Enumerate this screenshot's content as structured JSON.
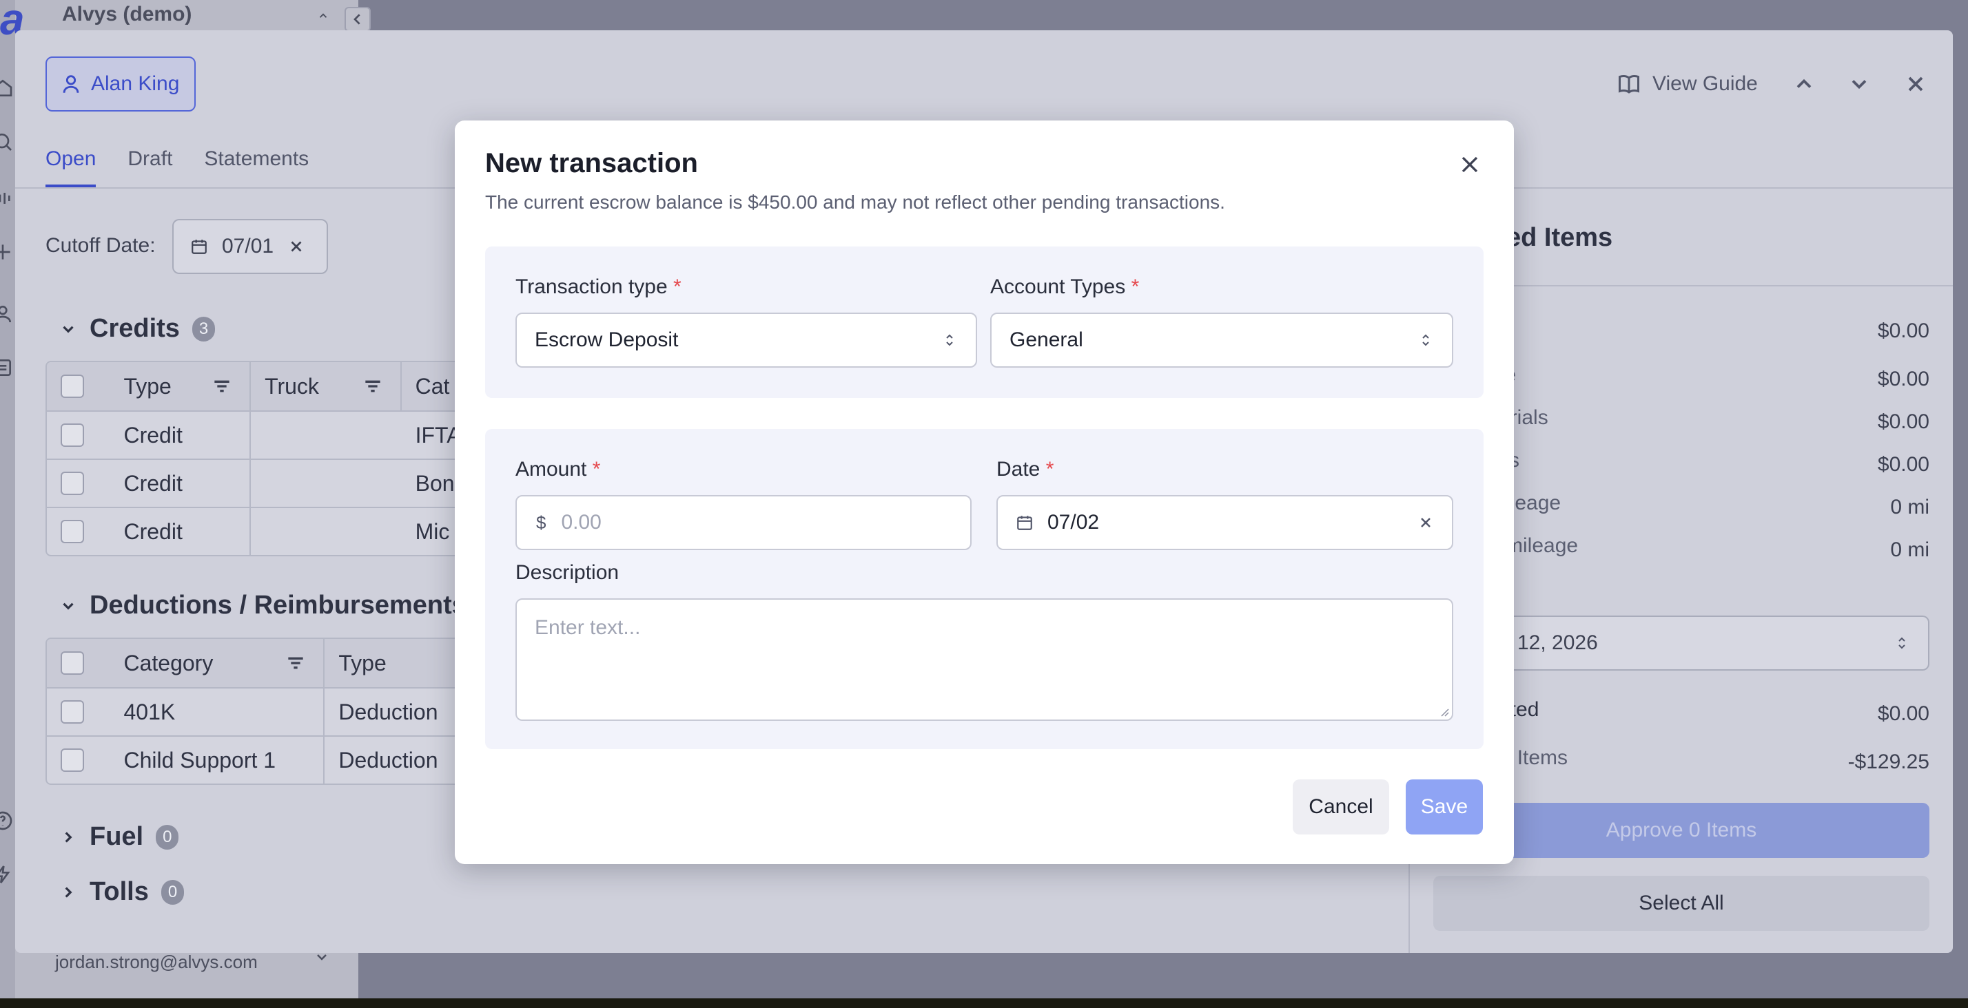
{
  "app": {
    "logo": "a",
    "org_name": "Alvys (demo)",
    "user_email": "jordan.strong@alvys.com"
  },
  "drawer": {
    "driver_name": "Alan King",
    "view_guide_label": "View Guide",
    "tabs": [
      {
        "label": "Open",
        "active": true
      },
      {
        "label": "Draft",
        "active": false
      },
      {
        "label": "Statements",
        "active": false
      }
    ],
    "cutoff": {
      "label": "Cutoff Date:",
      "value": "07/01"
    },
    "credits": {
      "title": "Credits",
      "count": "3",
      "columns": [
        "Type",
        "Truck",
        "Cat"
      ],
      "rows": [
        {
          "type": "Credit",
          "truck": "",
          "category": "IFTA"
        },
        {
          "type": "Credit",
          "truck": "",
          "category": "Bon"
        },
        {
          "type": "Credit",
          "truck": "",
          "category": "Mic"
        }
      ]
    },
    "deductions": {
      "title": "Deductions / Reimbursements",
      "columns": [
        "Category",
        "Type"
      ],
      "rows": [
        {
          "category": "401K",
          "type": "Deduction"
        },
        {
          "category": "Child Support 1",
          "type": "Deduction"
        }
      ]
    },
    "fuel": {
      "title": "Fuel",
      "count": "0"
    },
    "tolls": {
      "title": "Tolls",
      "count": "0"
    },
    "summary": {
      "title": "ed Items",
      "lines": [
        {
          "label": "",
          "value": "$0.00"
        },
        {
          "label": "lue",
          "value": "$0.00"
        },
        {
          "label": "sorials",
          "value": "$0.00"
        },
        {
          "label": "cks",
          "value": "$0.00"
        },
        {
          "label": "mileage",
          "value": "0 mi"
        },
        {
          "label": "d mileage",
          "value": "0 mi"
        }
      ],
      "period_label": "d",
      "period_value": "12, 2026",
      "selected_label": "ected",
      "selected_value": "$0.00",
      "pending_label": "ng Items",
      "pending_value": "-$129.25",
      "approve_label": "Approve 0 Items",
      "select_all_label": "Select All"
    }
  },
  "modal": {
    "title": "New transaction",
    "subtitle": "The current escrow balance is $450.00 and may not reflect other pending transactions.",
    "transaction_type": {
      "label": "Transaction type",
      "required": "*",
      "value": "Escrow Deposit"
    },
    "account_types": {
      "label": "Account Types",
      "required": "*",
      "value": "General"
    },
    "amount": {
      "label": "Amount",
      "required": "*",
      "currency": "$",
      "placeholder": "0.00"
    },
    "date": {
      "label": "Date",
      "required": "*",
      "value": "07/02"
    },
    "description": {
      "label": "Description",
      "placeholder": "Enter text..."
    },
    "cancel_label": "Cancel",
    "save_label": "Save"
  },
  "colors": {
    "accent": "#3b4cc8",
    "save_disabled": "#8fa4f4",
    "required": "#e5484d",
    "overlay": "#7d7f92"
  }
}
